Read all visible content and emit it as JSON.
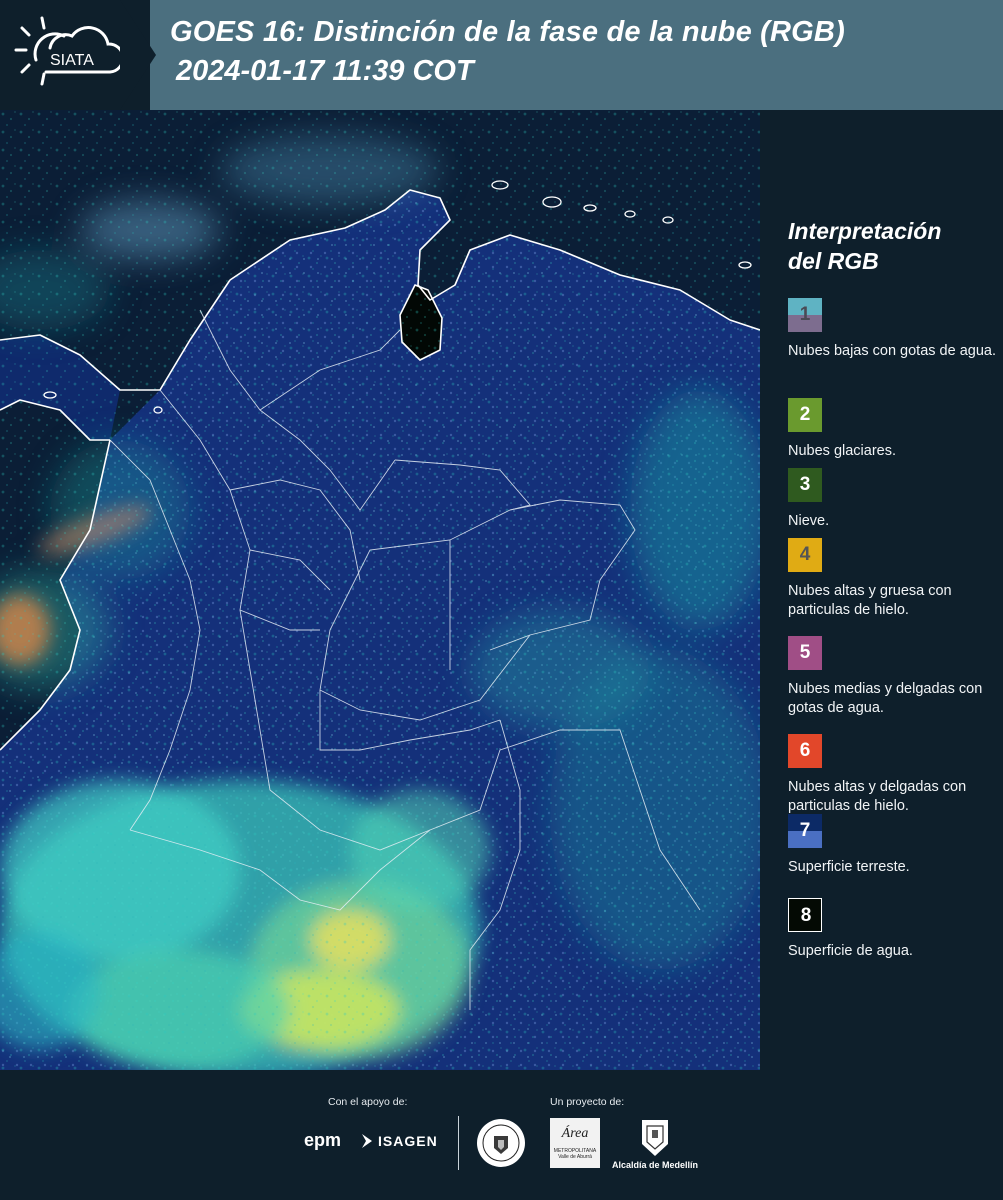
{
  "header": {
    "logo_text": "SIATA",
    "title_line1": "GOES 16: Distinción de la fase de la nube (RGB)",
    "title_line2": "2024-01-17 11:39 COT"
  },
  "legend": {
    "title_line1": "Interpretación",
    "title_line2": "del RGB",
    "items": [
      {
        "num": "1",
        "label": "Nubes bajas con gotas de agua.",
        "color_top": "#5fb3c3",
        "color_bottom": "#7d6d8f",
        "num_color": "#4a4a55"
      },
      {
        "num": "2",
        "label": "Nubes glaciares.",
        "color": "#6a9a2e",
        "num_color": "#ffffff"
      },
      {
        "num": "3",
        "label": "Nieve.",
        "color": "#2f5a1f",
        "num_color": "#ffffff"
      },
      {
        "num": "4",
        "label": "Nubes altas y gruesa con particulas de hielo.",
        "color": "#e0ab14",
        "num_color": "#555555"
      },
      {
        "num": "5",
        "label": "Nubes medias y delgadas con gotas de agua.",
        "color": "#a04e86",
        "num_color": "#ffffff"
      },
      {
        "num": "6",
        "label": "Nubes altas y delgadas con particulas de hielo.",
        "color": "#e2472a",
        "num_color": "#ffffff"
      },
      {
        "num": "7",
        "label": "Superficie terreste.",
        "color_top": "#0c2a66",
        "color_bottom": "#4a6fc2",
        "num_color": "#ffffff"
      },
      {
        "num": "8",
        "label": "Superficie de agua.",
        "color": "#040a04",
        "num_color": "#ffffff",
        "border": "#ffffff"
      }
    ]
  },
  "footer": {
    "support_label": "Con el apoyo de:",
    "project_label": "Un proyecto de:",
    "epm": "epm",
    "isagen": "ISAGEN",
    "area_name": "Área",
    "area_sub": "METROPOLITANA Valle de Aburrá",
    "medellin": "Alcaldía de Medellín"
  }
}
